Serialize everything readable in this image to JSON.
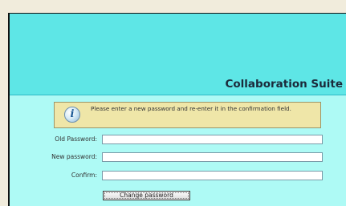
{
  "app": {
    "title": "Collaboration Suite"
  },
  "info": {
    "icon": "info-icon",
    "glyph": "i",
    "message": "Please enter a new password and re-enter it in the confirmation field."
  },
  "form": {
    "old_password_label": "Old Password:",
    "new_password_label": "New password:",
    "confirm_label": "Confirm:",
    "old_password_value": "",
    "new_password_value": "",
    "confirm_value": "",
    "submit_label": "Change password"
  },
  "colors": {
    "header_bg": "#5ee6e6",
    "content_bg": "#aefaf5",
    "info_bg": "#efe6a8",
    "page_bg": "#f1ecdc"
  }
}
